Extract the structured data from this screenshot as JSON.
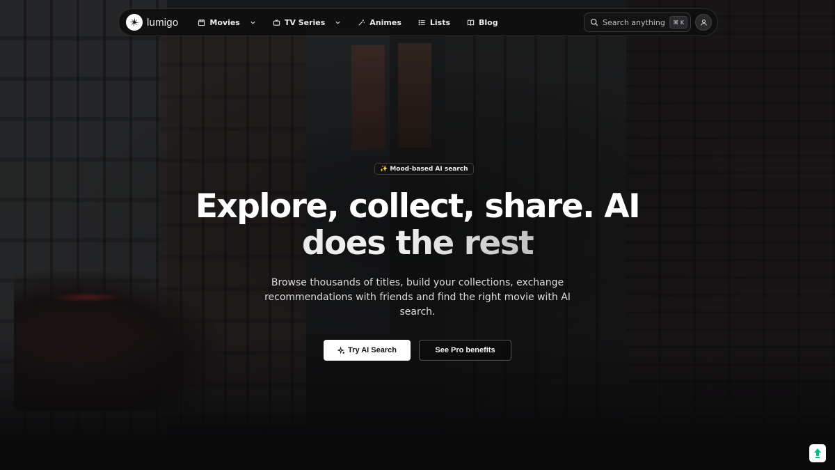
{
  "brand": {
    "name": "lumigo"
  },
  "nav": {
    "items": [
      {
        "label": "Movies",
        "icon": "clapperboard-icon",
        "has_dropdown": true
      },
      {
        "label": "TV Series",
        "icon": "tv-icon",
        "has_dropdown": true
      },
      {
        "label": "Animes",
        "icon": "wand-icon",
        "has_dropdown": false
      },
      {
        "label": "Lists",
        "icon": "list-icon",
        "has_dropdown": false
      },
      {
        "label": "Blog",
        "icon": "book-icon",
        "has_dropdown": false
      }
    ]
  },
  "search": {
    "placeholder": "Search anything",
    "shortcut": "⌘ K"
  },
  "hero": {
    "badge": "✨ Mood-based AI search",
    "headline_line1": "Explore, collect, share. AI",
    "headline_line2": "does the rest",
    "subtitle": "Browse thousands of titles, build your collections, exchange recommendations with friends and find the right movie with AI search.",
    "primary_button": "Try AI Search",
    "secondary_button": "See Pro benefits"
  },
  "colors": {
    "background": "#0d0d0f",
    "nav_bg": "#0e0e10",
    "primary_button_bg": "#ffffff",
    "text": "#ffffff",
    "widget_accent": "#10b981"
  }
}
